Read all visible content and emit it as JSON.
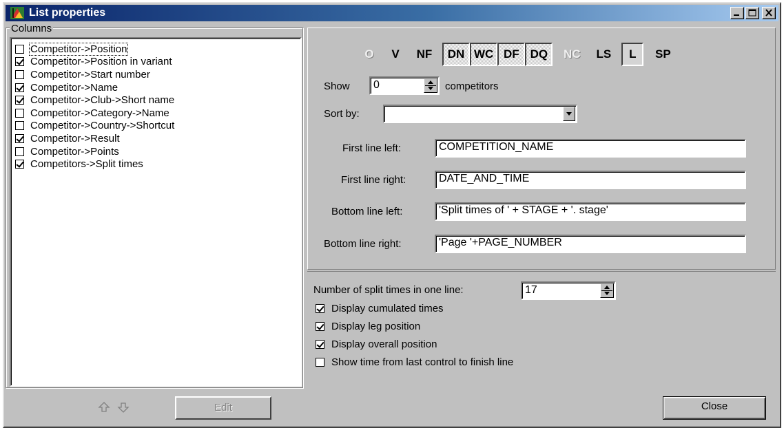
{
  "window": {
    "title": "List properties"
  },
  "columns": {
    "group_label": "Columns",
    "items": [
      {
        "label": "Competitor->Position",
        "checked": false,
        "focused": true
      },
      {
        "label": "Competitor->Position in variant",
        "checked": true
      },
      {
        "label": "Competitor->Start number",
        "checked": false
      },
      {
        "label": "Competitor->Name",
        "checked": true
      },
      {
        "label": "Competitor->Club->Short name",
        "checked": true
      },
      {
        "label": "Competitor->Category->Name",
        "checked": false
      },
      {
        "label": "Competitor->Country->Shortcut",
        "checked": false
      },
      {
        "label": "Competitor->Result",
        "checked": true
      },
      {
        "label": "Competitor->Points",
        "checked": false
      },
      {
        "label": "Competitors->Split times",
        "checked": true
      }
    ],
    "move_up_icon": "arrow-up-icon",
    "move_down_icon": "arrow-down-icon",
    "edit_label": "Edit"
  },
  "flags": [
    {
      "label": "O",
      "state": "white"
    },
    {
      "label": "V",
      "state": "normal"
    },
    {
      "label": "NF",
      "state": "normal"
    },
    {
      "label": "DN",
      "state": "pressed"
    },
    {
      "label": "WC",
      "state": "pressed"
    },
    {
      "label": "DF",
      "state": "pressed"
    },
    {
      "label": "DQ",
      "state": "pressed"
    },
    {
      "label": "NC",
      "state": "white"
    },
    {
      "label": "LS",
      "state": "normal"
    },
    {
      "label": "L",
      "state": "pressed-solid"
    },
    {
      "label": "SP",
      "state": "normal"
    }
  ],
  "show": {
    "label": "Show",
    "value": "0",
    "suffix": "competitors"
  },
  "sort_by": {
    "label": "Sort by:",
    "value": ""
  },
  "lines": {
    "first_left_label": "First line left:",
    "first_left_value": "COMPETITION_NAME",
    "first_right_label": "First line right:",
    "first_right_value": "DATE_AND_TIME",
    "bottom_left_label": "Bottom line left:",
    "bottom_left_value": "'Split times of ' + STAGE + '. stage'",
    "bottom_right_label": "Bottom line right:",
    "bottom_right_value": "'Page '+PAGE_NUMBER"
  },
  "split": {
    "count_label": "Number of split times in one line:",
    "count_value": "17",
    "options": [
      {
        "label": "Display cumulated times",
        "checked": true
      },
      {
        "label": "Display leg position",
        "checked": true
      },
      {
        "label": "Display overall position",
        "checked": true
      },
      {
        "label": "Show time from last control to finish line",
        "checked": false
      }
    ]
  },
  "buttons": {
    "close_label": "Close"
  }
}
